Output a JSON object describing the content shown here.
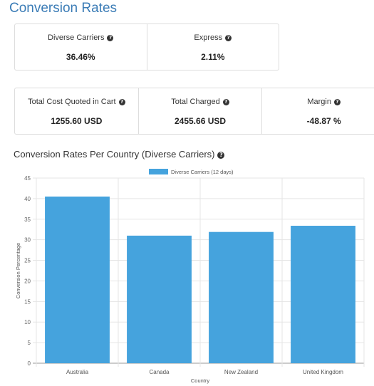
{
  "page": {
    "title": "Conversion Rates"
  },
  "stats_top": [
    {
      "label": "Diverse Carriers",
      "value": "36.46%"
    },
    {
      "label": "Express",
      "value": "2.11%"
    }
  ],
  "stats_bottom": [
    {
      "label": "Total Cost Quoted in Cart",
      "value": "1255.60 USD"
    },
    {
      "label": "Total Charged",
      "value": "2455.66 USD"
    },
    {
      "label": "Margin",
      "value": "-48.87 %"
    }
  ],
  "help_glyph": "?",
  "chart_section": {
    "title": "Conversion Rates Per Country (Diverse Carriers)"
  },
  "colors": {
    "title": "#3b7cb6",
    "bar": "#45a3dd",
    "grid": "#e5e5e5"
  },
  "chart_data": {
    "type": "bar",
    "title": "",
    "xlabel": "Country",
    "ylabel": "Conversion Percentage",
    "categories": [
      "Australia",
      "Canada",
      "New Zealand",
      "United Kingdom"
    ],
    "series": [
      {
        "name": "Diverse Carriers (12 days)",
        "values": [
          40.5,
          31.0,
          31.9,
          33.4
        ]
      }
    ],
    "ylim": [
      0,
      45
    ],
    "yticks": [
      0,
      5,
      10,
      15,
      20,
      25,
      30,
      35,
      40,
      45
    ],
    "grid": true,
    "legend": "top-center"
  }
}
